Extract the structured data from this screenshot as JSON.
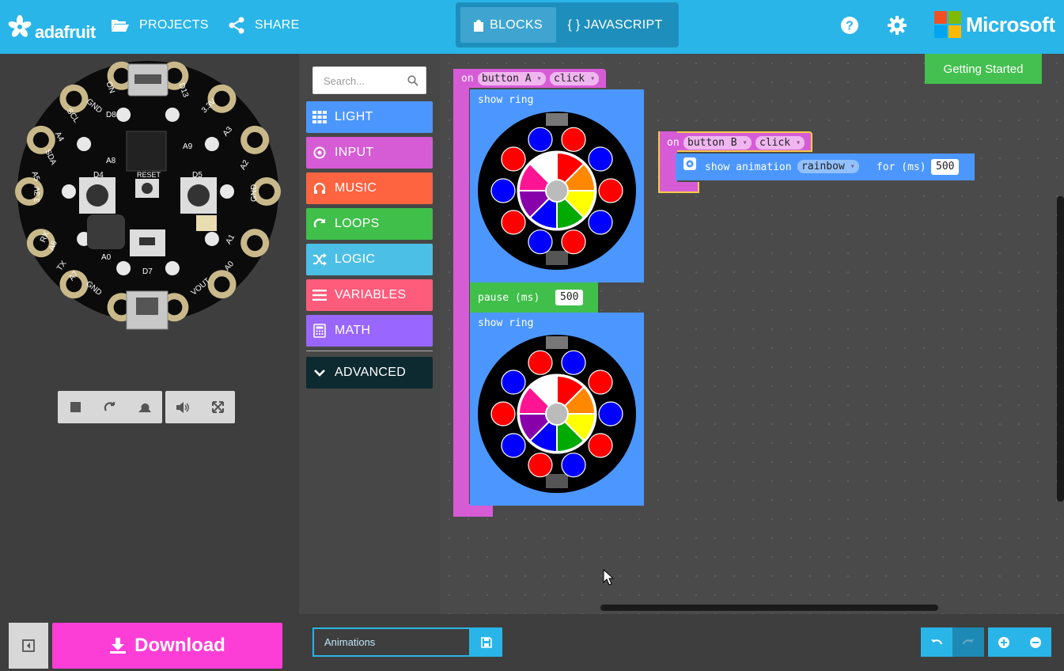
{
  "header": {
    "brand": "adafruit",
    "projects_label": "PROJECTS",
    "share_label": "SHARE",
    "blocks_label": "BLOCKS",
    "javascript_label": "{ } JAVASCRIPT",
    "microsoft_label": "Microsoft"
  },
  "toolbox": {
    "search_placeholder": "Search...",
    "categories": [
      {
        "label": "LIGHT",
        "color": "#4c97ff",
        "icon": "grid-icon"
      },
      {
        "label": "INPUT",
        "color": "#d65cd6",
        "icon": "target-icon"
      },
      {
        "label": "MUSIC",
        "color": "#fe6440",
        "icon": "headphones-icon"
      },
      {
        "label": "LOOPS",
        "color": "#40bf4a",
        "icon": "refresh-icon"
      },
      {
        "label": "LOGIC",
        "color": "#4cbfe6",
        "icon": "shuffle-icon"
      },
      {
        "label": "VARIABLES",
        "color": "#ff5c7c",
        "icon": "list-icon"
      },
      {
        "label": "MATH",
        "color": "#9966ff",
        "icon": "calculator-icon"
      }
    ],
    "advanced_label": "ADVANCED"
  },
  "board": {
    "pin_labels": {
      "a0": "A0",
      "a1": "A1",
      "a2": "A2",
      "a3": "A3",
      "a4": "A4",
      "a5": "A5",
      "a6": "A6",
      "a7": "A7",
      "gnd": "GND",
      "v33": "3.3V",
      "vout": "VOUT",
      "rx": "RX",
      "tx": "TX",
      "scl": "SCL",
      "sda": "SDA",
      "d4": "D4",
      "d5": "D5",
      "d7": "D7",
      "d8": "D8",
      "d13": "D13",
      "a8": "A8",
      "a9": "A9",
      "reset": "RESET",
      "on": "ON"
    }
  },
  "workspace": {
    "getting_started": "Getting Started",
    "block_a": {
      "on": "on",
      "button": "button A",
      "event": "click",
      "show_ring_1": "show ring",
      "pause": "pause (ms)",
      "pause_value": "500",
      "show_ring_2": "show ring",
      "ring1": [
        "#ff0000",
        "#0000ff",
        "#ff0000",
        "#0000ff",
        "#ff0000",
        "#0000ff",
        "#ff0000",
        "#0000ff",
        "#ff0000",
        "#0000ff"
      ],
      "ring2": [
        "#0000ff",
        "#ff0000",
        "#0000ff",
        "#ff0000",
        "#0000ff",
        "#ff0000",
        "#0000ff",
        "#ff0000",
        "#0000ff",
        "#ff0000"
      ]
    },
    "block_b": {
      "on": "on",
      "button": "button B",
      "event": "click",
      "show_animation": "show animation",
      "animation": "rainbow",
      "for": "for (ms)",
      "duration": "500"
    }
  },
  "bottom": {
    "download_label": "Download",
    "project_name": "Animations"
  }
}
